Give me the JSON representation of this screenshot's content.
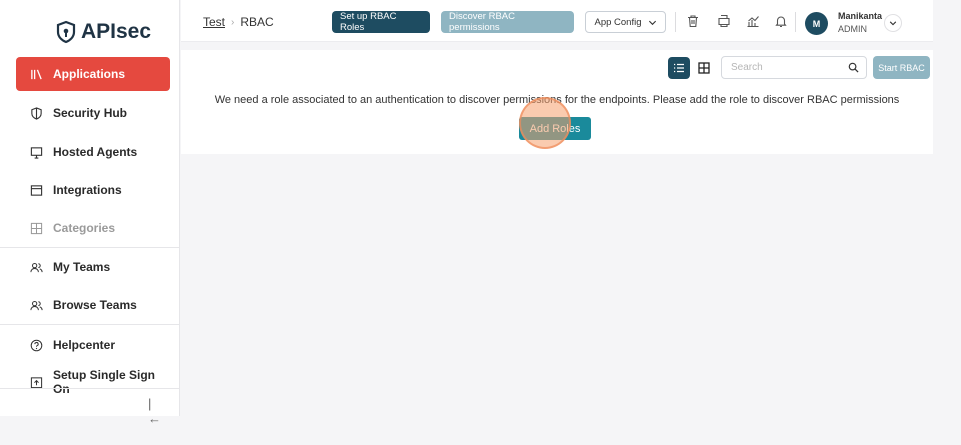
{
  "brand": {
    "name": "APIsec"
  },
  "sidebar": {
    "items": [
      {
        "label": "Applications",
        "icon": "applications-icon"
      },
      {
        "label": "Security Hub",
        "icon": "shield-icon"
      },
      {
        "label": "Hosted Agents",
        "icon": "monitor-icon"
      },
      {
        "label": "Integrations",
        "icon": "window-icon"
      },
      {
        "label": "Categories",
        "icon": "grid-icon"
      },
      {
        "label": "My Teams",
        "icon": "team-icon"
      },
      {
        "label": "Browse Teams",
        "icon": "team-icon"
      },
      {
        "label": "Helpcenter",
        "icon": "help-icon"
      },
      {
        "label": "Setup Single Sign On",
        "icon": "sso-icon"
      }
    ],
    "collapse_glyph": "|←"
  },
  "header": {
    "breadcrumb": {
      "parent": "Test",
      "current": "RBAC"
    },
    "setup_button": "Set up RBAC Roles",
    "discover_button": "Discover RBAC permissions",
    "app_config_button": "App Config",
    "user": {
      "initial": "M",
      "name": "Manikanta",
      "role": "ADMIN"
    }
  },
  "content": {
    "search_placeholder": "Search",
    "start_button": "Start RBAC",
    "message": "We need a role associated to an authentication to discover permissions for the endpoints. Please add the role to discover RBAC permissions",
    "add_roles_button": "Add Roles"
  },
  "colors": {
    "accent_red": "#e5493f",
    "primary_dark": "#1e4c61",
    "muted_teal": "#8fb5c2",
    "action_teal": "#1a8a9b"
  }
}
